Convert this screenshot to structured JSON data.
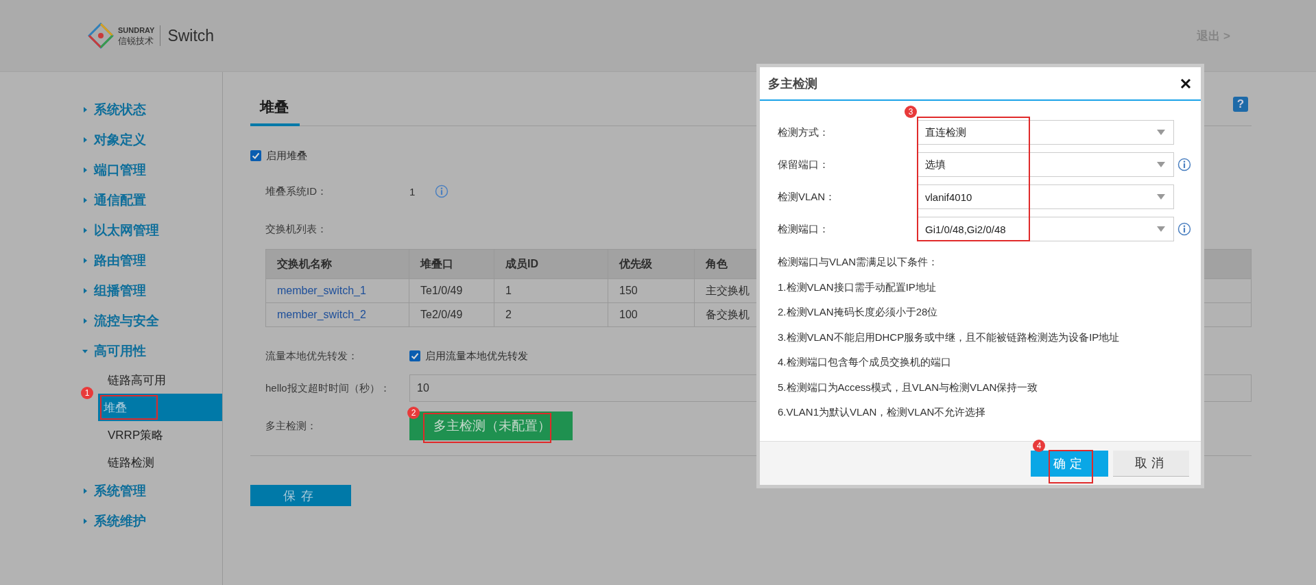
{
  "header": {
    "brand_top": "SUNDRAY",
    "brand_bottom": "信锐技术",
    "product": "Switch",
    "logout": "退出 >"
  },
  "sidebar": {
    "items": [
      {
        "label": "系统状态",
        "expanded": false
      },
      {
        "label": "对象定义",
        "expanded": false
      },
      {
        "label": "端口管理",
        "expanded": false
      },
      {
        "label": "通信配置",
        "expanded": false
      },
      {
        "label": "以太网管理",
        "expanded": false
      },
      {
        "label": "路由管理",
        "expanded": false
      },
      {
        "label": "组播管理",
        "expanded": false
      },
      {
        "label": "流控与安全",
        "expanded": false
      },
      {
        "label": "高可用性",
        "expanded": true,
        "children": [
          {
            "label": "链路高可用",
            "selected": false
          },
          {
            "label": "堆叠",
            "selected": true,
            "annotation": "1"
          },
          {
            "label": "VRRP策略",
            "selected": false
          },
          {
            "label": "链路检测",
            "selected": false
          }
        ]
      },
      {
        "label": "系统管理",
        "expanded": false
      },
      {
        "label": "系统维护",
        "expanded": false
      }
    ]
  },
  "page": {
    "tabs": [
      {
        "label": "堆叠",
        "selected": true
      }
    ],
    "help": "?",
    "enable_stack": {
      "label": "启用堆叠",
      "checked": true
    },
    "stack_id": {
      "label": "堆叠系统ID：",
      "value": "1"
    },
    "switch_list": {
      "label": "交换机列表：",
      "columns": [
        "交换机名称",
        "堆叠口",
        "成员ID",
        "优先级",
        "角色"
      ],
      "rows": [
        [
          "member_switch_1",
          "Te1/0/49",
          "1",
          "150",
          "主交换机"
        ],
        [
          "member_switch_2",
          "Te2/0/49",
          "2",
          "100",
          "备交换机"
        ]
      ]
    },
    "local_forward": {
      "label": "流量本地优先转发：",
      "checkbox_label": "启用流量本地优先转发",
      "checked": true
    },
    "hello_timeout": {
      "label": "hello报文超时时间（秒）：",
      "value": "10"
    },
    "multi_active": {
      "label": "多主检测：",
      "button": "多主检测（未配置）",
      "annotation": "2"
    },
    "save_button": "保存"
  },
  "dialog": {
    "title": "多主检测",
    "annotation": "3",
    "fields": [
      {
        "label": "检测方式：",
        "value": "直连检测",
        "info": false
      },
      {
        "label": "保留端口：",
        "value": "选填",
        "info": true
      },
      {
        "label": "检测VLAN：",
        "value": "vlanif4010",
        "info": false
      },
      {
        "label": "检测端口：",
        "value": "Gi1/0/48,Gi2/0/48",
        "info": true
      }
    ],
    "notes": [
      "检测端口与VLAN需满足以下条件：",
      "1.检测VLAN接口需手动配置IP地址",
      "2.检测VLAN掩码长度必须小于28位",
      "3.检测VLAN不能启用DHCP服务或中继，且不能被链路检测选为设备IP地址",
      "4.检测端口包含每个成员交换机的端口",
      "5.检测端口为Access模式，且VLAN与检测VLAN保持一致",
      "6.VLAN1为默认VLAN，检测VLAN不允许选择"
    ],
    "buttons": [
      {
        "label": "确定",
        "kind": "primary",
        "annotation": "4"
      },
      {
        "label": "取消",
        "kind": "secondary"
      }
    ]
  }
}
